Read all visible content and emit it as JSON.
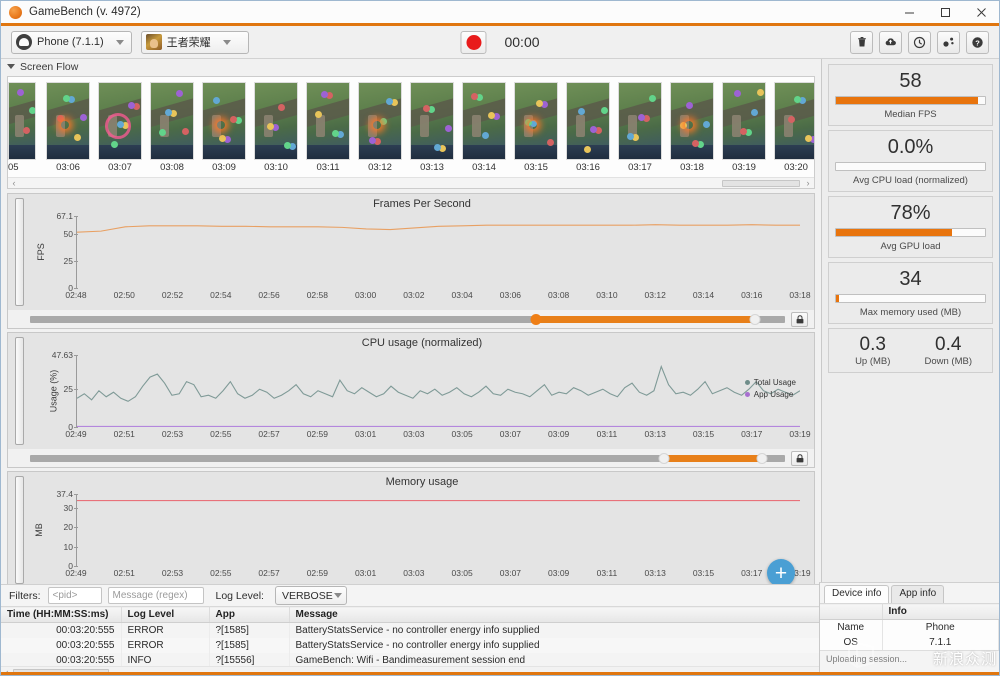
{
  "window": {
    "title": "GameBench (v. 4972)",
    "logo_icon": "gamebench-logo-icon",
    "minimize_label": "minimize-icon",
    "maximize_label": "maximize-icon",
    "close_label": "close-icon",
    "accent_color": "#e0760f"
  },
  "toolbar": {
    "device": {
      "label": "Phone (7.1.1)",
      "icon": "android-robot-icon"
    },
    "app": {
      "label": "王者荣耀",
      "icon": "game-app-icon"
    },
    "record": {
      "icon": "record-dot-icon",
      "timer": "00:00"
    },
    "actions": [
      {
        "name": "delete-button",
        "icon": "trash-icon"
      },
      {
        "name": "upload-button",
        "icon": "cloud-upload-icon"
      },
      {
        "name": "history-button",
        "icon": "clock-icon"
      },
      {
        "name": "settings-button",
        "icon": "share-nodes-icon"
      },
      {
        "name": "help-button",
        "icon": "question-circle-icon"
      }
    ]
  },
  "screen_flow": {
    "title": "Screen Flow",
    "collapse_icon": "triangle-down-icon",
    "frames": [
      {
        "time": "05",
        "clipped": true
      },
      {
        "time": "03:06"
      },
      {
        "time": "03:07"
      },
      {
        "time": "03:08"
      },
      {
        "time": "03:09"
      },
      {
        "time": "03:10"
      },
      {
        "time": "03:11"
      },
      {
        "time": "03:12"
      },
      {
        "time": "03:13"
      },
      {
        "time": "03:14"
      },
      {
        "time": "03:15"
      },
      {
        "time": "03:16"
      },
      {
        "time": "03:17"
      },
      {
        "time": "03:18"
      },
      {
        "time": "03:19"
      },
      {
        "time": "03:20"
      }
    ],
    "scroll_left_icon": "chevron-left-icon",
    "scroll_right_icon": "chevron-right-icon"
  },
  "chart_data": [
    {
      "type": "line",
      "name": "fps-chart",
      "title": "Frames Per Second",
      "xlabel": "",
      "ylabel": "FPS",
      "yticks": [
        "0",
        "25",
        "50",
        "67.1"
      ],
      "ylim": [
        0,
        67.1
      ],
      "xticks": [
        "02:48",
        "02:50",
        "02:52",
        "02:54",
        "02:56",
        "02:58",
        "03:00",
        "03:02",
        "03:04",
        "03:06",
        "03:08",
        "03:10",
        "03:12",
        "03:14",
        "03:16",
        "03:18"
      ],
      "grid": false,
      "legend": [],
      "series": [
        {
          "name": "FPS",
          "color": "#e8a063",
          "values": [
            52,
            53,
            57,
            58,
            58,
            58,
            57.5,
            57.5,
            57,
            57,
            57,
            56.5,
            55,
            54.5,
            56,
            57.5,
            58,
            58.5,
            58.5,
            58.5,
            58.5,
            58.5,
            58.5,
            58.5,
            59,
            58.5,
            58.5,
            58.5,
            59,
            58.5,
            58.5
          ]
        }
      ],
      "range_slider": {
        "start_pct": 67,
        "end_pct": 96,
        "lock_icon": "lock-icon"
      }
    },
    {
      "type": "line",
      "name": "cpu-chart",
      "title": "CPU usage (normalized)",
      "xlabel": "",
      "ylabel": "Usage (%)",
      "yticks": [
        "0",
        "25",
        "47.63"
      ],
      "ylim": [
        0,
        47.63
      ],
      "xticks": [
        "02:49",
        "02:51",
        "02:53",
        "02:55",
        "02:57",
        "02:59",
        "03:01",
        "03:03",
        "03:05",
        "03:07",
        "03:09",
        "03:11",
        "03:13",
        "03:15",
        "03:17",
        "03:19"
      ],
      "grid": false,
      "legend": [
        {
          "label": "Total Usage",
          "color": "#6f8d8a"
        },
        {
          "label": "App Usage",
          "color": "#a86fd0"
        }
      ],
      "series": [
        {
          "name": "Total Usage",
          "color": "#7f9a97",
          "values": [
            19,
            22,
            18,
            24,
            20,
            23,
            19,
            17,
            20,
            27,
            33,
            35,
            29,
            21,
            22,
            30,
            28,
            20,
            21,
            19,
            24,
            30,
            22,
            19,
            21,
            25,
            23,
            19,
            21,
            24,
            28,
            22,
            20,
            24,
            22,
            20,
            31,
            24,
            22,
            26,
            23,
            20,
            22,
            27,
            23,
            21,
            19,
            24,
            22,
            25,
            21,
            23,
            26,
            22,
            20,
            23,
            27,
            22,
            21,
            25,
            23,
            22,
            20,
            24,
            28,
            21,
            23,
            22,
            26,
            24,
            21,
            23,
            25,
            22,
            20,
            26,
            29,
            23,
            21,
            24,
            40,
            28,
            22,
            23,
            21,
            25,
            30,
            22,
            24,
            26,
            23,
            21,
            25,
            30,
            24,
            22,
            25,
            23,
            21,
            24
          ]
        },
        {
          "name": "App Usage",
          "color": "#b487dd",
          "values": [
            0.4,
            0.4,
            0.4,
            0.4,
            0.4,
            0.4,
            0.4,
            0.4,
            0.4,
            0.4,
            0.4,
            0.4,
            0.4,
            0.4,
            0.4,
            0.4,
            0.4,
            0.4,
            0.4,
            0.4,
            0.4,
            0.4,
            0.4,
            0.4,
            0.4,
            0.4,
            0.4,
            0.4,
            0.4,
            0.4,
            0.4
          ]
        }
      ],
      "range_slider": {
        "start_pct": 84,
        "end_pct": 97,
        "lock_icon": "lock-icon"
      }
    },
    {
      "type": "line",
      "name": "memory-chart",
      "title": "Memory usage",
      "xlabel": "",
      "ylabel": "MB",
      "yticks": [
        "0",
        "10",
        "20",
        "30",
        "37.4"
      ],
      "ylim": [
        0,
        37.4
      ],
      "xticks": [
        "02:49",
        "02:51",
        "02:53",
        "02:55",
        "02:57",
        "02:59",
        "03:01",
        "03:03",
        "03:05",
        "03:07",
        "03:09",
        "03:11",
        "03:13",
        "03:15",
        "03:17",
        "03:19"
      ],
      "grid": false,
      "legend": [],
      "series": [
        {
          "name": "Memory (MB)",
          "color": "#e8717a",
          "values": [
            34,
            34,
            34,
            34,
            34,
            34,
            34,
            34,
            34,
            34,
            34,
            34,
            34,
            34,
            34,
            34,
            34,
            34,
            34,
            34,
            34,
            34,
            34,
            34,
            34,
            34,
            34,
            34,
            34,
            34,
            34
          ]
        }
      ],
      "range_slider": {
        "start_pct": 84,
        "end_pct": 97,
        "lock_icon": "lock-icon"
      }
    }
  ],
  "fab": {
    "icon": "plus-icon",
    "label": "+",
    "color": "#4a9fd4"
  },
  "log_panel": {
    "filters_label": "Filters:",
    "pid_placeholder": "<pid>",
    "message_placeholder": "Message (regex)",
    "log_level_label": "Log Level:",
    "log_level_value": "VERBOSE",
    "columns": [
      "Time (HH:MM:SS:ms)",
      "Log Level",
      "App",
      "Message"
    ],
    "rows": [
      {
        "time": "00:03:20:555",
        "level": "ERROR",
        "app": "?[1585]",
        "message": "BatteryStatsService - no controller energy info supplied"
      },
      {
        "time": "00:03:20:555",
        "level": "ERROR",
        "app": "?[1585]",
        "message": "BatteryStatsService - no controller energy info supplied"
      },
      {
        "time": "00:03:20:555",
        "level": "INFO",
        "app": "?[15556]",
        "message": "GameBench: Wifi - Bandimeasurement session end"
      }
    ],
    "scroll_left_icon": "chevron-left-icon"
  },
  "stats": [
    {
      "name": "median-fps",
      "value": "58",
      "label": "Median FPS",
      "fill_pct": 95,
      "color": "#e8740d"
    },
    {
      "name": "avg-cpu-load",
      "value": "0.0%",
      "label": "Avg CPU load (normalized)",
      "fill_pct": 0,
      "color": "#e8740d"
    },
    {
      "name": "avg-gpu-load",
      "value": "78%",
      "label": "Avg GPU load",
      "fill_pct": 78,
      "color": "#e8740d"
    },
    {
      "name": "max-memory-used",
      "value": "34",
      "label": "Max memory used (MB)",
      "fill_pct": 2,
      "color": "#e8740d"
    }
  ],
  "network": {
    "up": {
      "value": "0.3",
      "label": "Up (MB)"
    },
    "down": {
      "value": "0.4",
      "label": "Down (MB)"
    }
  },
  "device_info": {
    "tabs": [
      {
        "label": "Device info",
        "active": true
      },
      {
        "label": "App info",
        "active": false
      }
    ],
    "columns": [
      "",
      "Info"
    ],
    "rows": [
      {
        "key": "Name",
        "value": "Phone"
      },
      {
        "key": "OS",
        "value": "7.1.1"
      }
    ],
    "footer": "Uploading session..."
  },
  "watermark": {
    "text": "新浪众测",
    "icon": "watermark-cube-icon"
  }
}
